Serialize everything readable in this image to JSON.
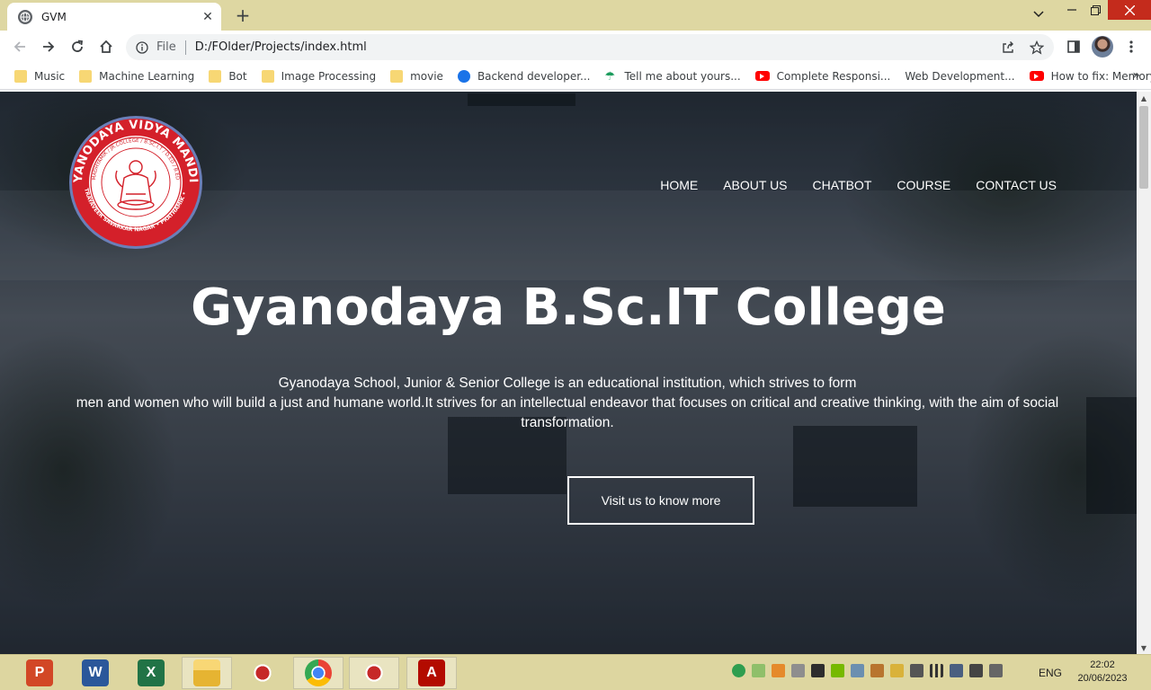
{
  "browser": {
    "tab_title": "GVM",
    "scheme_label": "File",
    "url": "D:/FOlder/Projects/index.html"
  },
  "bookmarks": [
    {
      "label": "Music",
      "icon": "folder-icon"
    },
    {
      "label": "Machine Learning",
      "icon": "folder-icon"
    },
    {
      "label": "Bot",
      "icon": "folder-icon"
    },
    {
      "label": "Image Processing",
      "icon": "folder-icon"
    },
    {
      "label": "movie",
      "icon": "folder-icon"
    },
    {
      "label": "Backend developer...",
      "icon": "angular-icon"
    },
    {
      "label": "Tell me about yours...",
      "icon": "umbrella-icon"
    },
    {
      "label": "Complete Responsi...",
      "icon": "youtube-icon"
    },
    {
      "label": "Web Development...",
      "icon": "none"
    },
    {
      "label": "How to fix: Memory...",
      "icon": "youtube-icon"
    }
  ],
  "page": {
    "logo_text": {
      "top": "GYANODAYA VIDYA MANDIR",
      "inner": "MADHYAMIK / JR.COLLEGE / B.SC.I.T / D.ED / B.ED",
      "bottom": "SWATANTRAYAVEER SAVARKAR NAGAR • PRATHAMIK • COLLEGE"
    },
    "nav": [
      "HOME",
      "ABOUT US",
      "CHATBOT",
      "COURSE",
      "CONTACT US"
    ],
    "hero_title": "Gyanodaya B.Sc.IT College",
    "hero_desc_line1": "Gyanodaya School, Junior & Senior College is an educational institution, which strives to form",
    "hero_desc_line2": "men and women who will build a just and humane world.It strives for an intellectual endeavor that focuses on critical and creative thinking, with the aim of social transformation.",
    "cta_label": "Visit us to know more"
  },
  "taskbar": {
    "apps": [
      "powerpoint-icon",
      "word-icon",
      "excel-icon",
      "file-explorer-icon",
      "spider-app-icon",
      "chrome-icon",
      "spider-app-icon",
      "acrobat-icon"
    ],
    "language": "ENG",
    "time": "22:02",
    "date": "20/06/2023"
  }
}
